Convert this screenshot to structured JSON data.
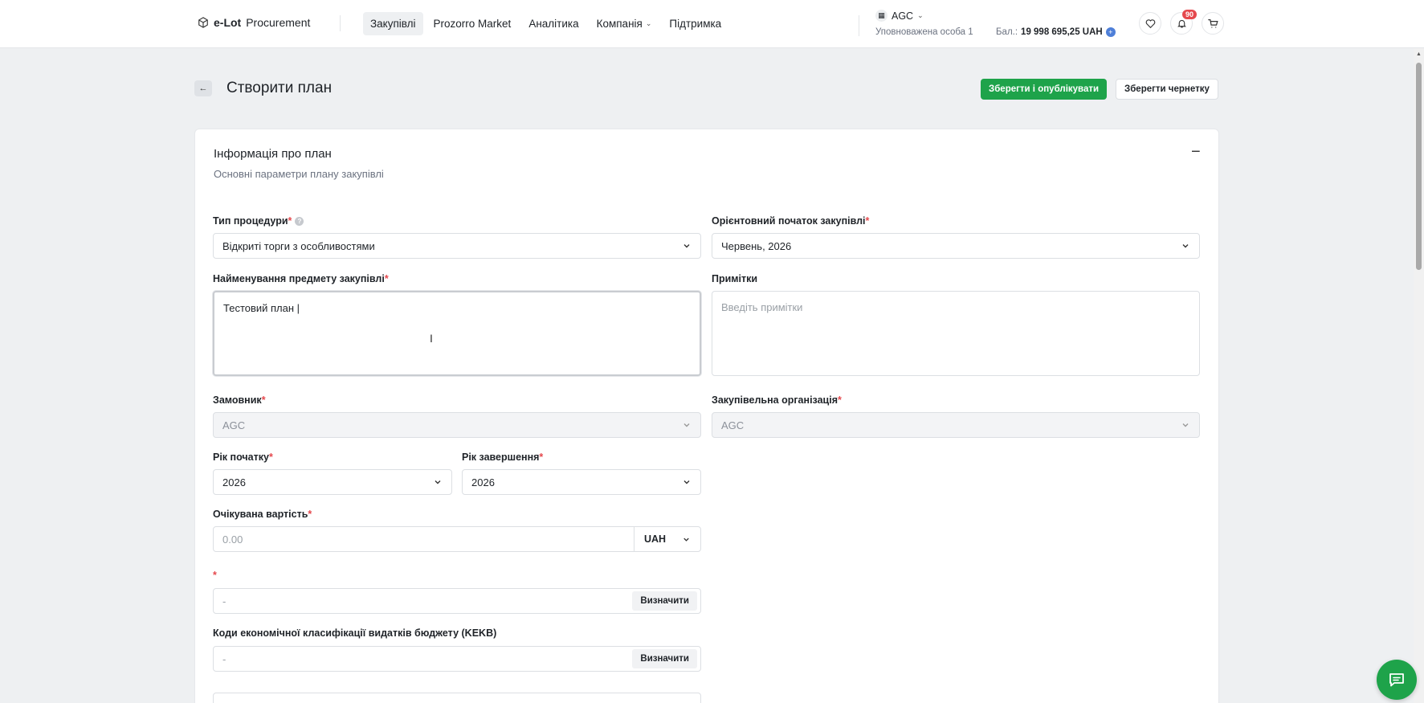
{
  "app": {
    "logo_bold": "e-Lot",
    "logo_rest": "Procurement"
  },
  "nav": {
    "items": [
      {
        "label": "Закупівлі",
        "active": true
      },
      {
        "label": "Prozorro Market"
      },
      {
        "label": "Аналітика"
      },
      {
        "label": "Компанія",
        "has_dropdown": true
      },
      {
        "label": "Підтримка"
      }
    ]
  },
  "account": {
    "org": "AGC",
    "role": "Уповноважена особа 1",
    "balance_label": "Бал.:",
    "balance_value": "19 998 695,25 UAH",
    "notifications": "90"
  },
  "page": {
    "title": "Створити план",
    "publish_label": "Зберегти і опублікувати",
    "draft_label": "Зберегти чернетку"
  },
  "card": {
    "title": "Інформація про план",
    "subtitle": "Основні параметри плану закупівлі"
  },
  "form": {
    "procedure_type": {
      "label": "Тип процедури",
      "value": "Відкриті торги з особливостями"
    },
    "start_month": {
      "label": "Орієнтовний початок закупівлі",
      "value": "Червень, 2026"
    },
    "subject_name": {
      "label": "Найменування предмету закупівлі",
      "value": "Тестовий план |"
    },
    "notes": {
      "label": "Примітки",
      "placeholder": "Введіть примітки"
    },
    "customer": {
      "label": "Замовник",
      "value": "AGC"
    },
    "procuring_org": {
      "label": "Закупівельна організація",
      "value": "AGC"
    },
    "start_year": {
      "label": "Рік початку",
      "value": "2026"
    },
    "end_year": {
      "label": "Рік завершення",
      "value": "2026"
    },
    "expected_value": {
      "label": "Очікувана вартість",
      "placeholder": "0.00",
      "currency": "UAH"
    },
    "classifier": {
      "label": "",
      "value": "-",
      "button": "Визначити"
    },
    "kekv": {
      "label": "Коди економічної класифікації видатків бюджету (KEKB)",
      "value": "-",
      "button": "Визначити"
    }
  },
  "colors": {
    "accent_green": "#1ea34a",
    "required": "#e5484d"
  }
}
